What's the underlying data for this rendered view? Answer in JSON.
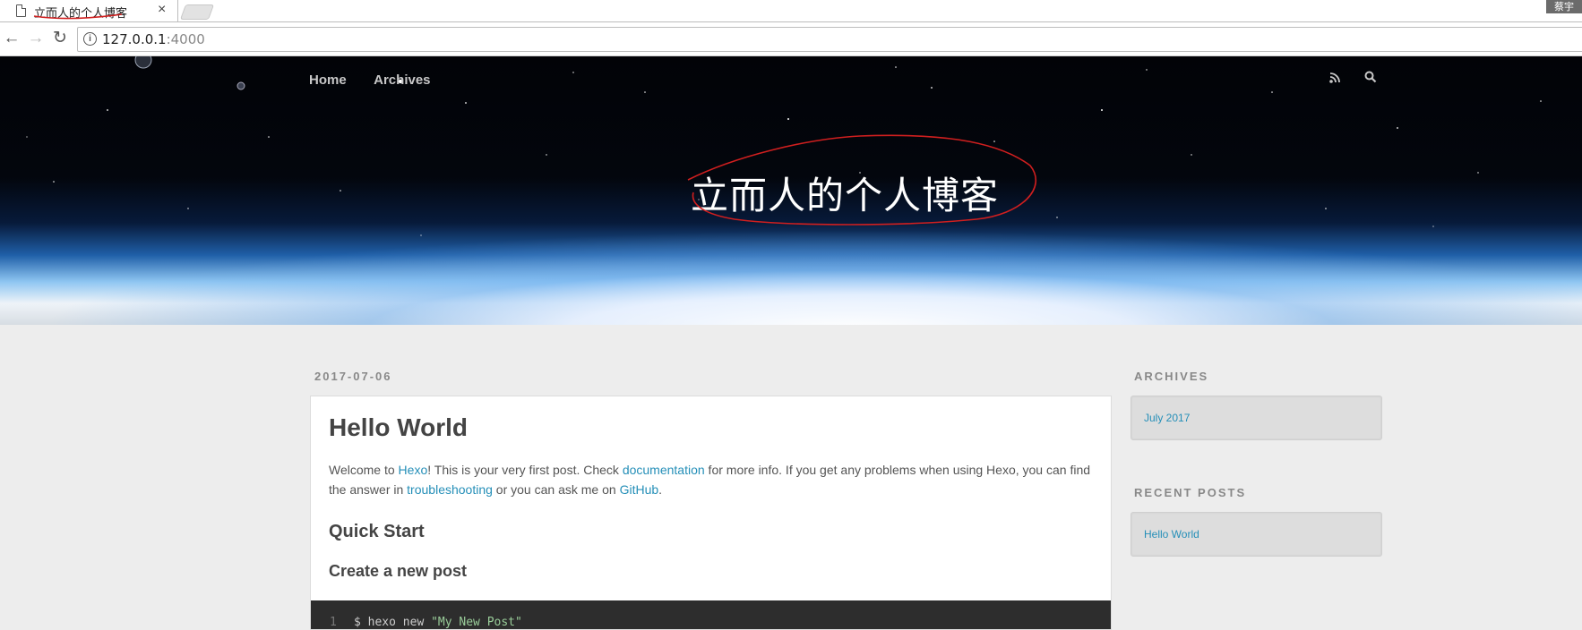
{
  "browser": {
    "tab_title": "立而人的个人博客",
    "profile_label": "蔡宇",
    "url_host": "127.0.0.1",
    "url_port": ":4000"
  },
  "nav": {
    "home": "Home",
    "archives": "Archives",
    "icons": [
      "rss-icon",
      "search-icon"
    ]
  },
  "banner": {
    "site_title": "立而人的个人博客"
  },
  "post": {
    "date": "2017-07-06",
    "title": "Hello World",
    "intro_1": "Welcome to ",
    "link_hexo": "Hexo",
    "intro_2": "! This is your very first post. Check ",
    "link_documentation": "documentation",
    "intro_3": " for more info. If you get any problems when using Hexo, you can find the answer in ",
    "link_troubleshooting": "troubleshooting",
    "intro_4": " or you can ask me on ",
    "link_github": "GitHub",
    "intro_5": ".",
    "h_quick_start": "Quick Start",
    "h_create_post": "Create a new post",
    "code_line_no": "1",
    "code_cmd": "$ hexo new ",
    "code_arg": "\"My New Post\""
  },
  "sidebar": {
    "archives_title": "ARCHIVES",
    "archives_item": "July 2017",
    "recent_title": "RECENT POSTS",
    "recent_item": "Hello World"
  },
  "colors": {
    "link": "#258fb8",
    "annotation": "#d01f1f"
  }
}
